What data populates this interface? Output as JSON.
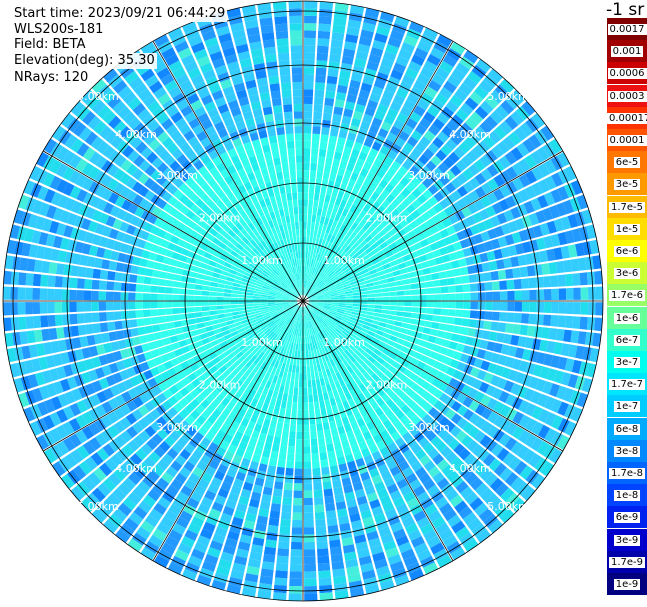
{
  "info": {
    "start_time": "Start time: 2023/09/21 06:44:29",
    "instrument": "WLS200s-181",
    "field": "Field: BETA",
    "elevation": "Elevation(deg): 35.30",
    "nrays": "NRays: 120"
  },
  "range_labels": [
    "1.00km",
    "2.00km",
    "3.00km",
    "4.00km",
    "5.00km"
  ],
  "colorbar": {
    "title": "-1 sr",
    "labels": [
      "0.0017",
      "0.001",
      "0.0006",
      "0.0003",
      "0.00017",
      "0.0001",
      "6e-5",
      "3e-5",
      "1.7e-5",
      "1e-5",
      "6e-6",
      "3e-6",
      "1.7e-6",
      "1e-6",
      "6e-7",
      "3e-7",
      "1.7e-7",
      "1e-7",
      "6e-8",
      "3e-8",
      "1.7e-8",
      "1e-8",
      "6e-9",
      "3e-9",
      "1.7e-9",
      "1e-9"
    ],
    "colors": [
      "#800000",
      "#a00000",
      "#cc0000",
      "#ee1111",
      "#ff3300",
      "#ff5500",
      "#ff7700",
      "#ff9900",
      "#ffbb00",
      "#ffdd00",
      "#ffff00",
      "#ccff33",
      "#99ff66",
      "#66ff99",
      "#33ffcc",
      "#00ffee",
      "#00e6ff",
      "#00ccff",
      "#00aaff",
      "#0088ff",
      "#0066ff",
      "#0044ff",
      "#0022ee",
      "#0000cc",
      "#0000aa",
      "#000080"
    ]
  },
  "palette": {
    "base": "#33ccff",
    "variants": [
      "#33ddee",
      "#22bbff",
      "#3399ff",
      "#00ccff",
      "#66eedd"
    ],
    "grid": "#000000",
    "label_color": "#ffffff"
  }
}
